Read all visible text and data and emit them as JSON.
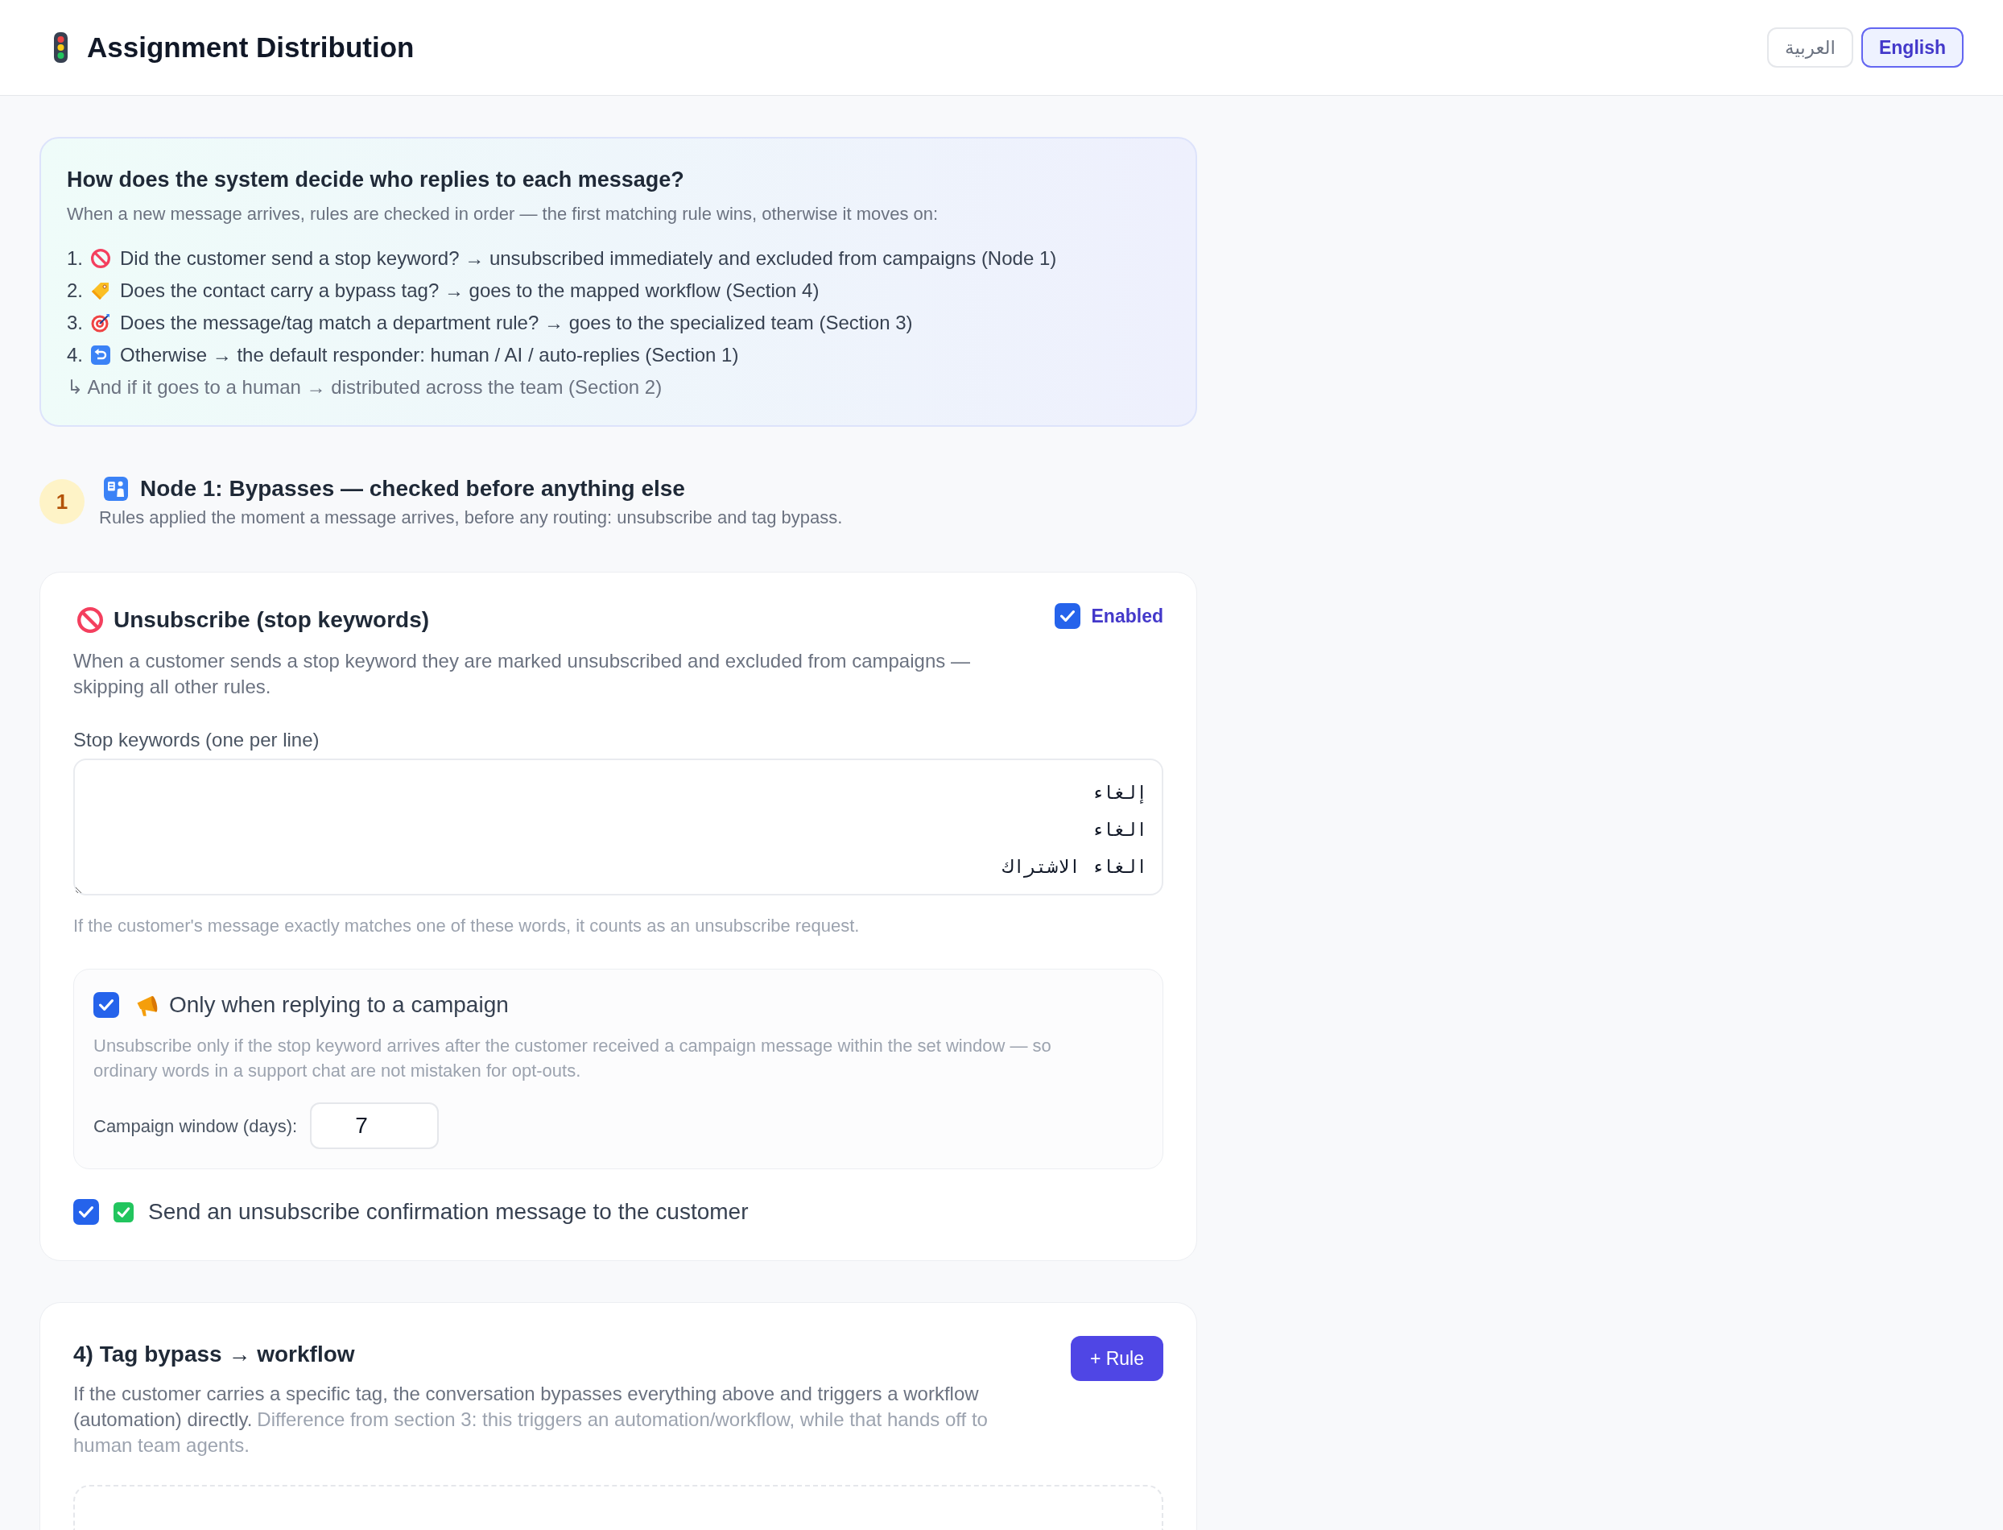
{
  "header": {
    "title": "Assignment Distribution",
    "languages": [
      {
        "label": "العربية",
        "selected": false
      },
      {
        "label": "English",
        "selected": true
      }
    ]
  },
  "info_panel": {
    "title": "How does the system decide who replies to each message?",
    "subtitle": "When a new message arrives, rules are checked in order — the first matching rule wins, otherwise it moves on:",
    "steps": [
      {
        "number": "1.",
        "text": "Did the customer send a stop keyword? → unsubscribed immediately and excluded from campaigns (Node 1)"
      },
      {
        "number": "2.",
        "text": "Does the contact carry a bypass tag? → goes to the mapped workflow (Section 4)"
      },
      {
        "number": "3.",
        "text": "Does the message/tag match a department rule? → goes to the specialized team (Section 3)"
      },
      {
        "number": "4.",
        "text": "Otherwise → the default responder: human / AI / auto-replies (Section 1)"
      }
    ],
    "footnote": "↳ And if it goes to a human → distributed across the team (Section 2)"
  },
  "node": {
    "number": "1",
    "title": "Node 1: Bypasses — checked before anything else",
    "subtitle": "Rules applied the moment a message arrives, before any routing: unsubscribe and tag bypass."
  },
  "unsubscribe_card": {
    "title": "Unsubscribe (stop keywords)",
    "enabled": {
      "label": "Enabled",
      "checked": true
    },
    "description": "When a customer sends a stop keyword they are marked unsubscribed and excluded from campaigns — skipping all other rules.",
    "keywords_label": "Stop keywords (one per line)",
    "keywords_value": "إلغاء\nالغاء\nالغاء الاشتراك",
    "hint": "If the customer's message exactly matches one of these words, it counts as an unsubscribe request.",
    "campaign_option": {
      "label": "Only when replying to a campaign",
      "checked": true,
      "description": "Unsubscribe only if the stop keyword arrives after the customer received a campaign message within the set window — so ordinary words in a support chat are not mistaken for opt-outs.",
      "window_label": "Campaign window (days):",
      "window_value": "7"
    },
    "confirmation": {
      "label": "Send an unsubscribe confirmation message to the customer",
      "checked": true
    }
  },
  "tag_bypass_card": {
    "title": "4) Tag bypass → workflow",
    "add_button": "+ Rule",
    "description": "If the customer carries a specific tag, the conversation bypasses everything above and triggers a workflow (automation) directly.",
    "description_note": "Difference from section 3: this triggers an automation/workflow, while that hands off to human team agents."
  }
}
